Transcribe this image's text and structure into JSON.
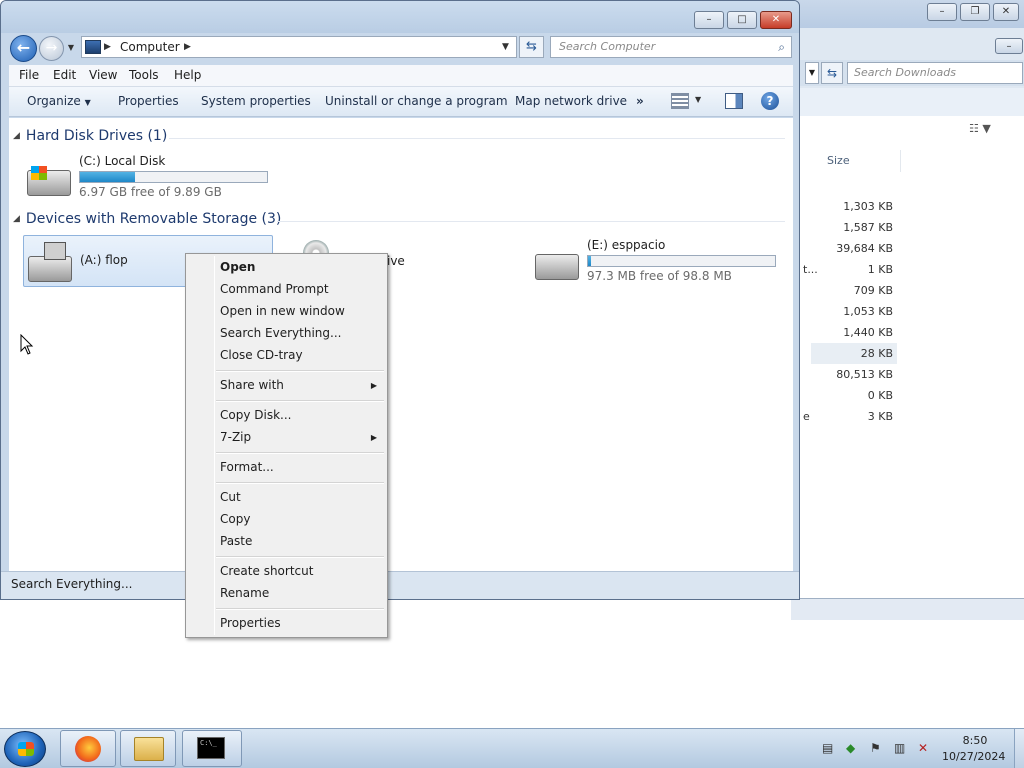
{
  "bg_window": {
    "search_placeholder": "Search Downloads",
    "column_size": "Size",
    "sizes": [
      "1,303 KB",
      "1,587 KB",
      "39,684 KB",
      "1 KB",
      "709 KB",
      "1,053 KB",
      "1,440 KB",
      "28 KB",
      "80,513 KB",
      "0 KB",
      "3 KB"
    ],
    "fragment_1": "t...",
    "fragment_2": "e"
  },
  "window": {
    "address": "Computer",
    "search_placeholder": "Search Computer",
    "menu": [
      "File",
      "Edit",
      "View",
      "Tools",
      "Help"
    ],
    "toolbar": {
      "organize": "Organize",
      "properties": "Properties",
      "system_properties": "System properties",
      "uninstall": "Uninstall or change a program",
      "map_drive": "Map network drive",
      "more": "»"
    },
    "groups": {
      "hdd": "Hard Disk Drives (1)",
      "removable": "Devices with Removable Storage (3)"
    },
    "drives": {
      "c": {
        "name": "(C:) Local Disk",
        "free": "6.97 GB free of 9.89 GB",
        "used_fraction": 0.295
      },
      "a": {
        "name": "(A:) flop"
      },
      "d_fragment": "ive",
      "e": {
        "name": "(E:) esppacio",
        "free": "97.3 MB free of 98.8 MB",
        "used_fraction": 0.015
      }
    },
    "status": "Search Everything..."
  },
  "context_menu": {
    "open": "Open",
    "command_prompt": "Command Prompt",
    "open_new_window": "Open in new window",
    "search_everything": "Search Everything...",
    "close_cd": "Close CD-tray",
    "share_with": "Share with",
    "copy_disk": "Copy Disk...",
    "seven_zip": "7-Zip",
    "format": "Format...",
    "cut": "Cut",
    "copy": "Copy",
    "paste": "Paste",
    "create_shortcut": "Create shortcut",
    "rename": "Rename",
    "properties": "Properties"
  },
  "taskbar": {
    "time": "8:50",
    "date": "10/27/2024",
    "cmd_icon_text": "C:\\_"
  }
}
